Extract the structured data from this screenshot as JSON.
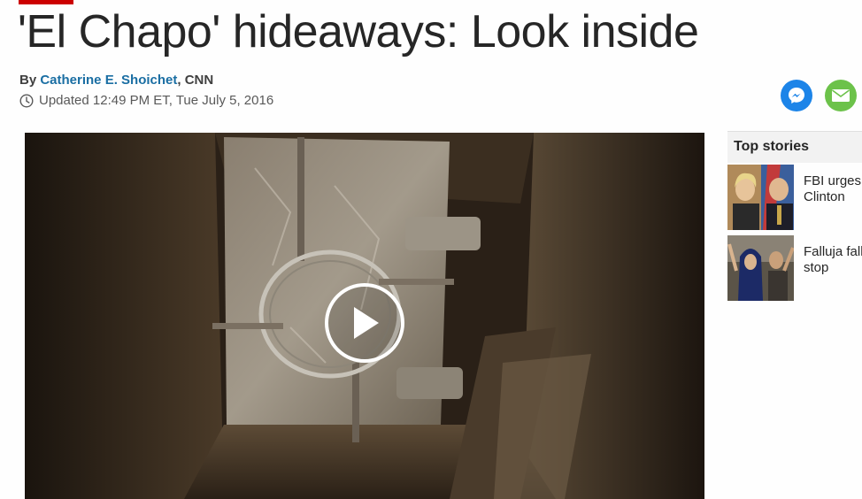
{
  "article": {
    "headline": "'El Chapo' hideaways: Look inside",
    "byline_prefix": "By ",
    "author": "Catherine E. Shoichet",
    "byline_suffix": ", CNN",
    "updated": "Updated 12:49 PM ET, Tue July 5, 2016"
  },
  "share": {
    "messenger_icon": "facebook-messenger-icon",
    "email_icon": "email-envelope-icon",
    "messenger_color": "#1c84e8",
    "email_color": "#6cc24a"
  },
  "video": {
    "play_icon": "play-icon"
  },
  "sidebar": {
    "title": "Top stories",
    "stories": [
      {
        "text_line1": "FBI urges",
        "text_line2": "Clinton"
      },
      {
        "text_line1": "Falluja fall",
        "text_line2": "stop"
      }
    ]
  },
  "colors": {
    "brand_red": "#cc0000",
    "author_link": "#1a6ea3"
  }
}
